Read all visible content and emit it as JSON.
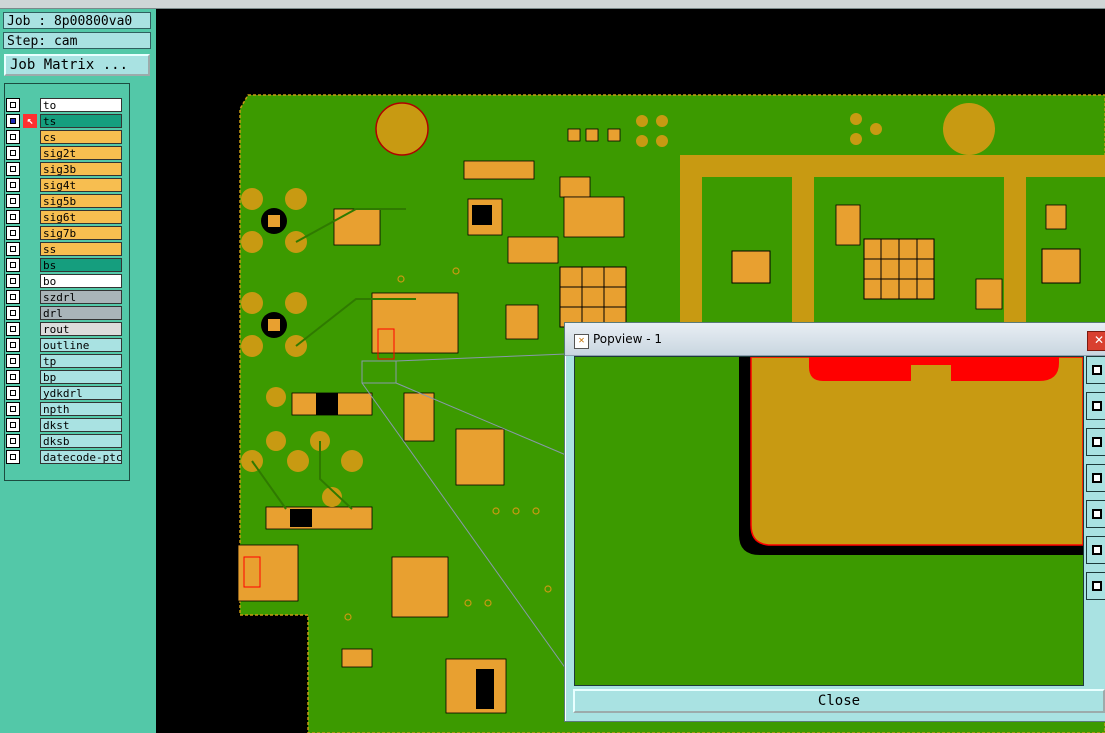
{
  "job": {
    "label": "Job : 8p00800va0"
  },
  "step": {
    "label": "Step: cam"
  },
  "job_matrix": {
    "label": "Job Matrix ..."
  },
  "layers_board": [
    {
      "name": "to",
      "color": "#ffffff",
      "checked": false,
      "icon": ""
    },
    {
      "name": "ts",
      "color": "#159e7e",
      "checked": true,
      "icon": "arrow"
    },
    {
      "name": "cs",
      "color": "#f7be50",
      "checked": false,
      "icon": ""
    },
    {
      "name": "sig2t",
      "color": "#f7be50",
      "checked": false,
      "icon": ""
    },
    {
      "name": "sig3b",
      "color": "#f7be50",
      "checked": false,
      "icon": ""
    },
    {
      "name": "sig4t",
      "color": "#f7be50",
      "checked": false,
      "icon": ""
    },
    {
      "name": "sig5b",
      "color": "#f7be50",
      "checked": false,
      "icon": ""
    },
    {
      "name": "sig6t",
      "color": "#f7be50",
      "checked": false,
      "icon": ""
    },
    {
      "name": "sig7b",
      "color": "#f7be50",
      "checked": false,
      "icon": ""
    },
    {
      "name": "ss",
      "color": "#f7be50",
      "checked": false,
      "icon": ""
    },
    {
      "name": "bs",
      "color": "#159e7e",
      "checked": false,
      "icon": ""
    },
    {
      "name": "bo",
      "color": "#ffffff",
      "checked": false,
      "icon": ""
    }
  ],
  "layers_drill": [
    {
      "name": "szdrl",
      "color": "#a9b4b8",
      "checked": false
    },
    {
      "name": "drl",
      "color": "#a9b4b8",
      "checked": false
    },
    {
      "name": "rout",
      "color": "#dcdcdc",
      "checked": false
    }
  ],
  "layers_misc": [
    {
      "name": "outline",
      "color": "#a9e2e2",
      "checked": false
    },
    {
      "name": "tp",
      "color": "#a9e2e2",
      "checked": false
    },
    {
      "name": "bp",
      "color": "#a9e2e2",
      "checked": false
    },
    {
      "name": "ydkdrl",
      "color": "#a9e2e2",
      "checked": false
    },
    {
      "name": "npth",
      "color": "#a9e2e2",
      "checked": false
    },
    {
      "name": "dkst",
      "color": "#a9e2e2",
      "checked": false
    },
    {
      "name": "dksb",
      "color": "#a9e2e2",
      "checked": false
    },
    {
      "name": "datecode-ptc",
      "color": "#a9e2e2",
      "checked": false
    }
  ],
  "popview": {
    "title": "Popview - 1",
    "close_label": "Close",
    "close_x": "✕"
  },
  "colors": {
    "board_green": "#3c9a00",
    "copper": "#c89a12",
    "pad_orange": "#e8a030",
    "highlight_red": "#ff0000",
    "panel_teal": "#53c8a8"
  }
}
